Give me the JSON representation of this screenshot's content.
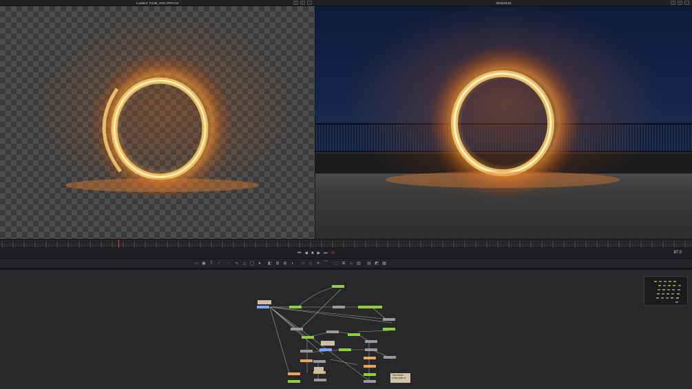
{
  "viewer_left": {
    "title": "Loader2: Portal_v001.####.exr"
  },
  "viewer_right": {
    "title": "MediaOut1"
  },
  "transport": {
    "frame": "87.0",
    "buttons": [
      "⏮",
      "◀",
      "■",
      "▶",
      "⏭"
    ],
    "loop": "⟲"
  },
  "node_editor": {
    "notes": [
      {
        "text": "This fusion comp adds a"
      }
    ]
  },
  "colors": {
    "background": "#1c1c1e",
    "accent_loop": "#e0483e",
    "node_green": "#8fd13c",
    "node_orange": "#e8a560",
    "node_blue": "#7aa6ff",
    "node_grey": "#9a9a9e"
  },
  "icons": {
    "toolbar": [
      "background-icon",
      "image-icon",
      "text-icon",
      "paint-icon",
      "mask-icon",
      "bspline-icon",
      "polygon-icon",
      "ellipse-icon",
      "rectangle-icon",
      "drop-icon",
      "blur-icon",
      "transform-icon",
      "merge-icon",
      "color-icon",
      "tracker-icon",
      "particles-icon",
      "3d-icon",
      "camera-icon",
      "light-icon",
      "renderer-icon",
      "output-icon"
    ]
  }
}
